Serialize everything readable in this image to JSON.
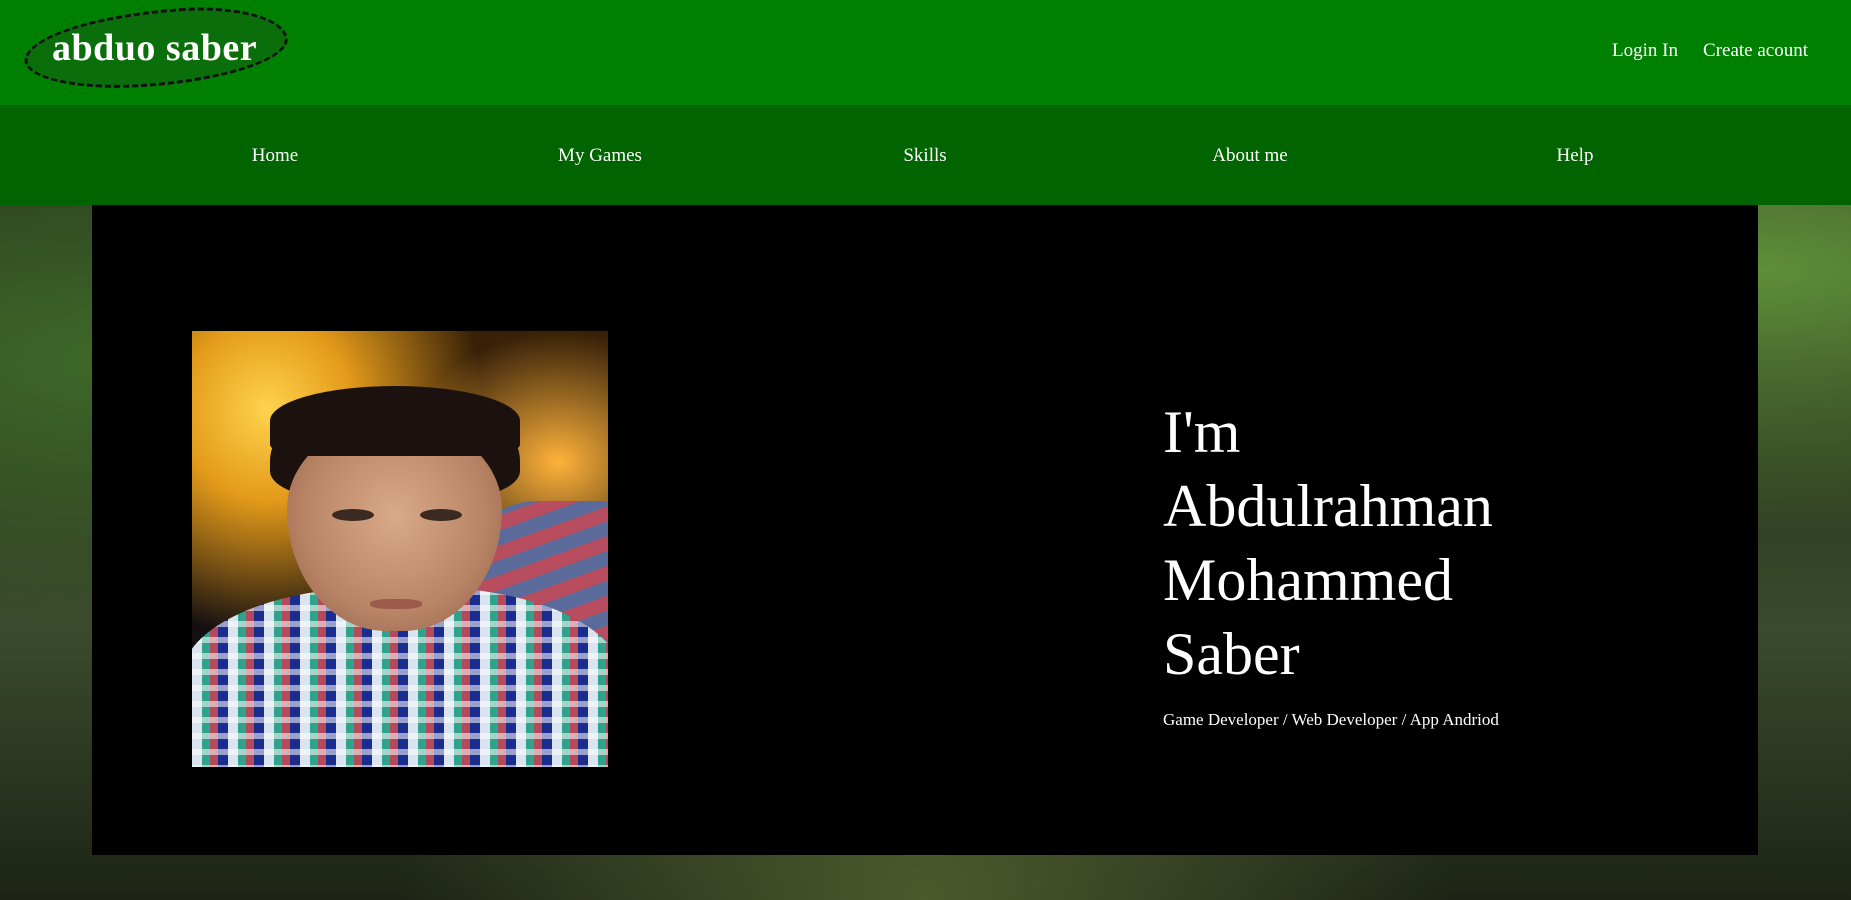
{
  "header": {
    "logo_text": "abduo saber",
    "login_label": "Login In",
    "create_account_label": "Create acount",
    "background_color": "#008000"
  },
  "nav": {
    "background_color": "#006400",
    "items": [
      {
        "label": "Home"
      },
      {
        "label": "My Games"
      },
      {
        "label": "Skills"
      },
      {
        "label": "About me"
      },
      {
        "label": "Help"
      }
    ]
  },
  "hero": {
    "background_color": "#000000",
    "headline_lines": [
      " I'm",
      "Abdulrahman",
      "Mohammed",
      "Saber"
    ],
    "tagline": "Game Developer / Web Developer / App Andriod",
    "portrait_alt": "profile-photo"
  }
}
